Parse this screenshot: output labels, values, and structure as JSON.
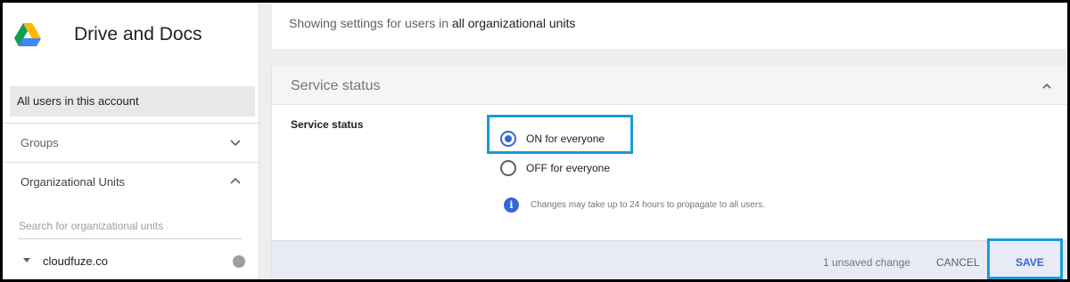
{
  "app": {
    "title": "Drive and Docs"
  },
  "sidebar": {
    "all_users": "All users in this account",
    "groups_label": "Groups",
    "org_units_label": "Organizational Units",
    "search_placeholder": "Search for organizational units",
    "org_unit": "cloudfuze.co"
  },
  "notice": {
    "prefix": "Showing settings for users in",
    "scope": "all organizational units"
  },
  "card": {
    "title": "Service status",
    "setting_label": "Service status",
    "options": [
      {
        "label": "ON for everyone",
        "selected": true
      },
      {
        "label": "OFF for everyone",
        "selected": false
      }
    ],
    "info": "Changes may take up to 24 hours to propagate to all users."
  },
  "footer": {
    "unsaved": "1 unsaved change",
    "cancel": "CANCEL",
    "save": "SAVE"
  },
  "colors": {
    "accent": "#3367d6",
    "highlight": "#1a9bd7",
    "footer_bg": "#e8eaf6"
  }
}
